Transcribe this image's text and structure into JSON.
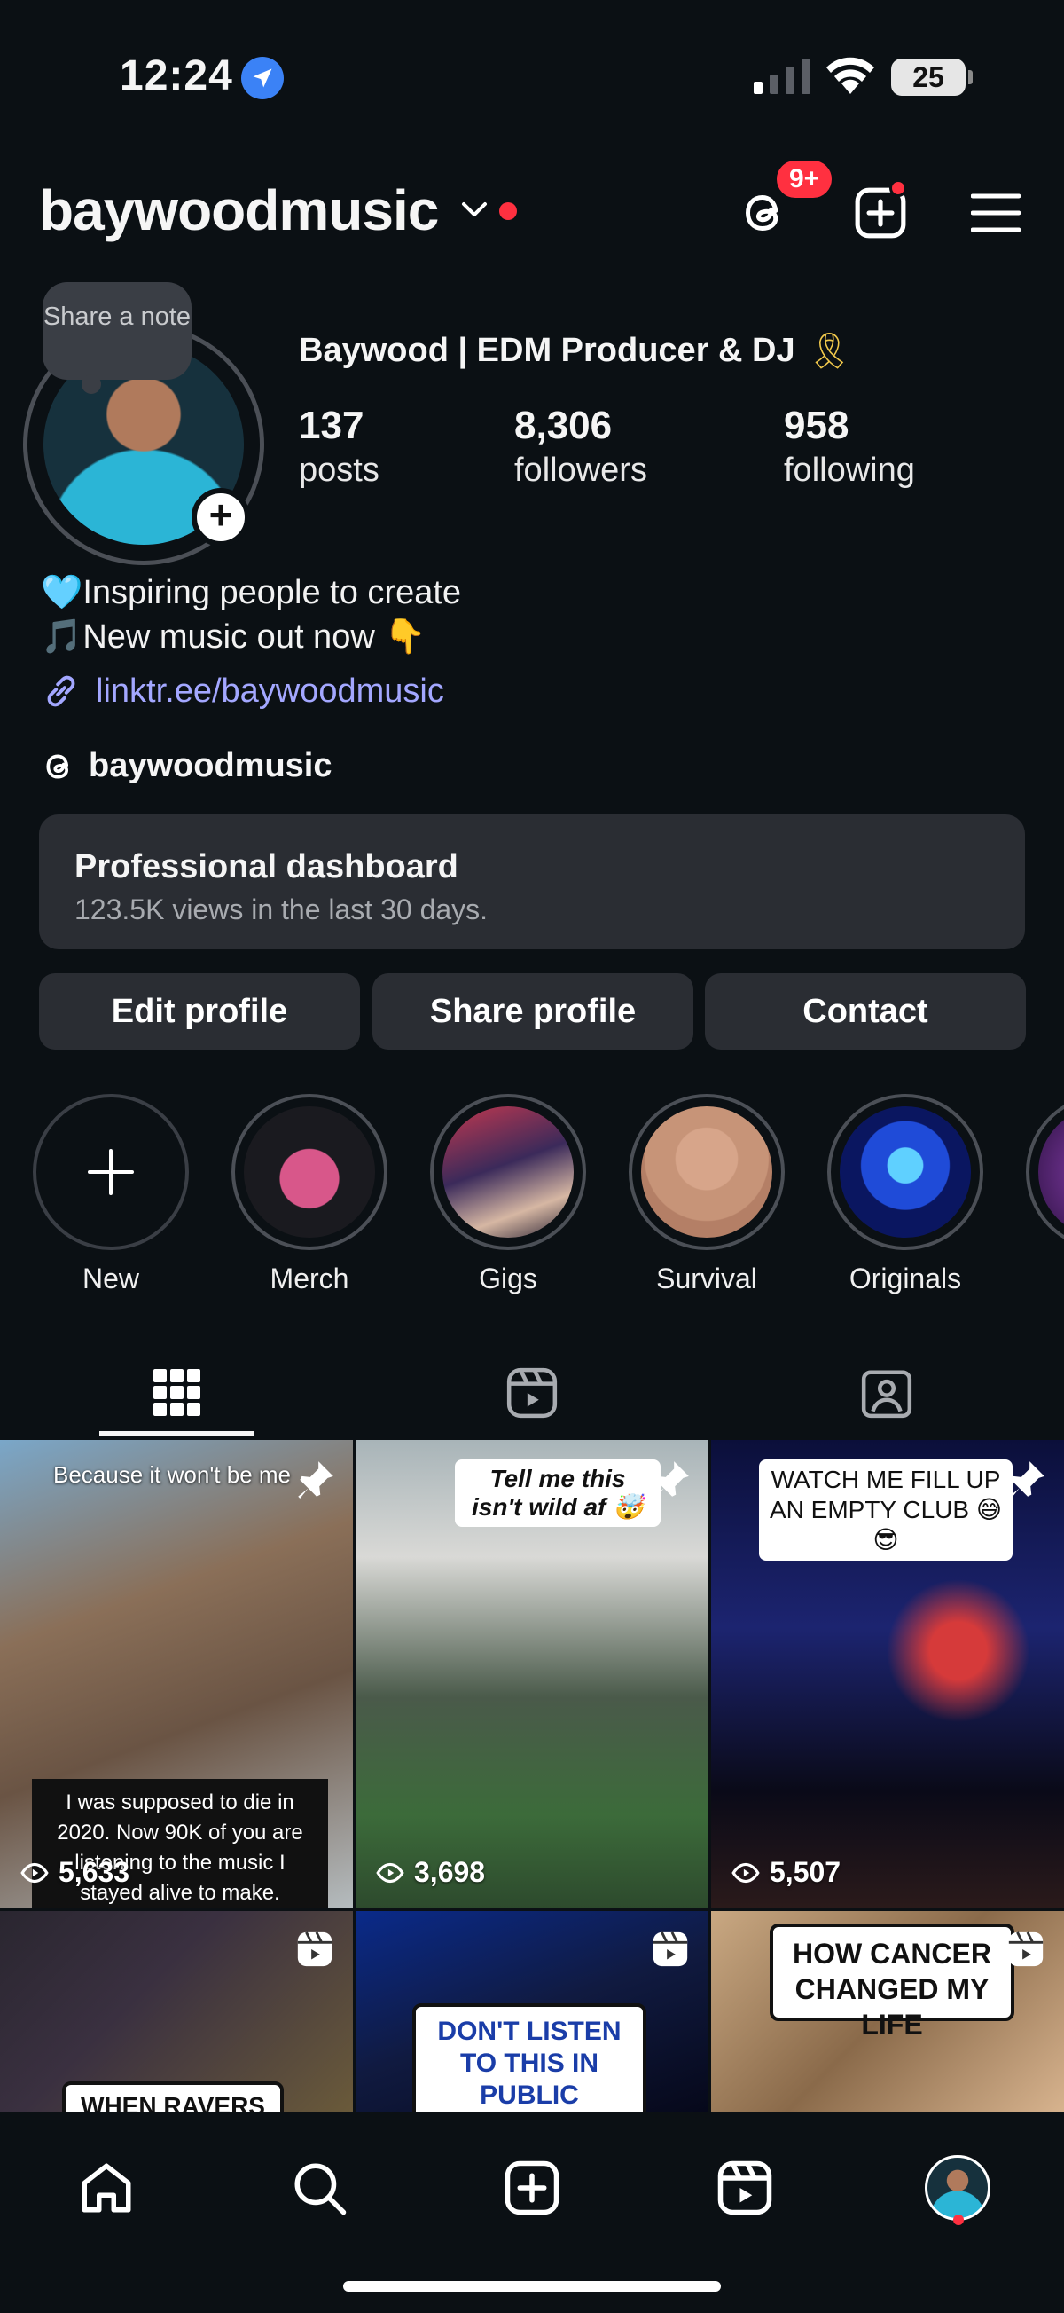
{
  "status_bar": {
    "time": "12:24",
    "battery": "25"
  },
  "header": {
    "username": "baywoodmusic",
    "threads_badge": "9+"
  },
  "profile": {
    "note_bubble": "Share a note",
    "display_name": "Baywood | EDM Producer & DJ",
    "display_name_emoji": "🎗",
    "stats": [
      {
        "value": "137",
        "label": "posts"
      },
      {
        "value": "8,306",
        "label": "followers"
      },
      {
        "value": "958",
        "label": "following"
      }
    ],
    "bio_lines": [
      "🩵Inspiring people to create",
      "🎵New music out now 👇"
    ],
    "link": "linktr.ee/baywoodmusic",
    "threads_handle": "baywoodmusic"
  },
  "dashboard": {
    "title": "Professional dashboard",
    "subtitle": "123.5K views in the last 30 days."
  },
  "buttons": {
    "edit": "Edit profile",
    "share": "Share profile",
    "contact": "Contact"
  },
  "highlights": [
    {
      "label": "New"
    },
    {
      "label": "Merch"
    },
    {
      "label": "Gigs"
    },
    {
      "label": "Survival"
    },
    {
      "label": "Originals"
    }
  ],
  "posts": [
    {
      "caption": "Because it won't be me",
      "overlay": "I was supposed to die in 2020. Now 90K of you are listening to the music I stayed alive to make.",
      "views": "5,633",
      "pinned": true
    },
    {
      "caption": "Tell me this isn't wild af 🤯",
      "views": "3,698",
      "pinned": true
    },
    {
      "caption": "WATCH ME FILL UP AN EMPTY CLUB 😅😎",
      "views": "5,507",
      "pinned": true
    },
    {
      "caption": "WHEN RAVERS MEET"
    },
    {
      "caption": "DON'T LISTEN TO THIS IN PUBLIC"
    },
    {
      "caption": "HOW CANCER CHANGED MY LIFE"
    }
  ],
  "colors": {
    "background": "#0b1014",
    "accent_red": "#ff3040",
    "link": "#a3a7ff",
    "card": "#2a2d33"
  }
}
